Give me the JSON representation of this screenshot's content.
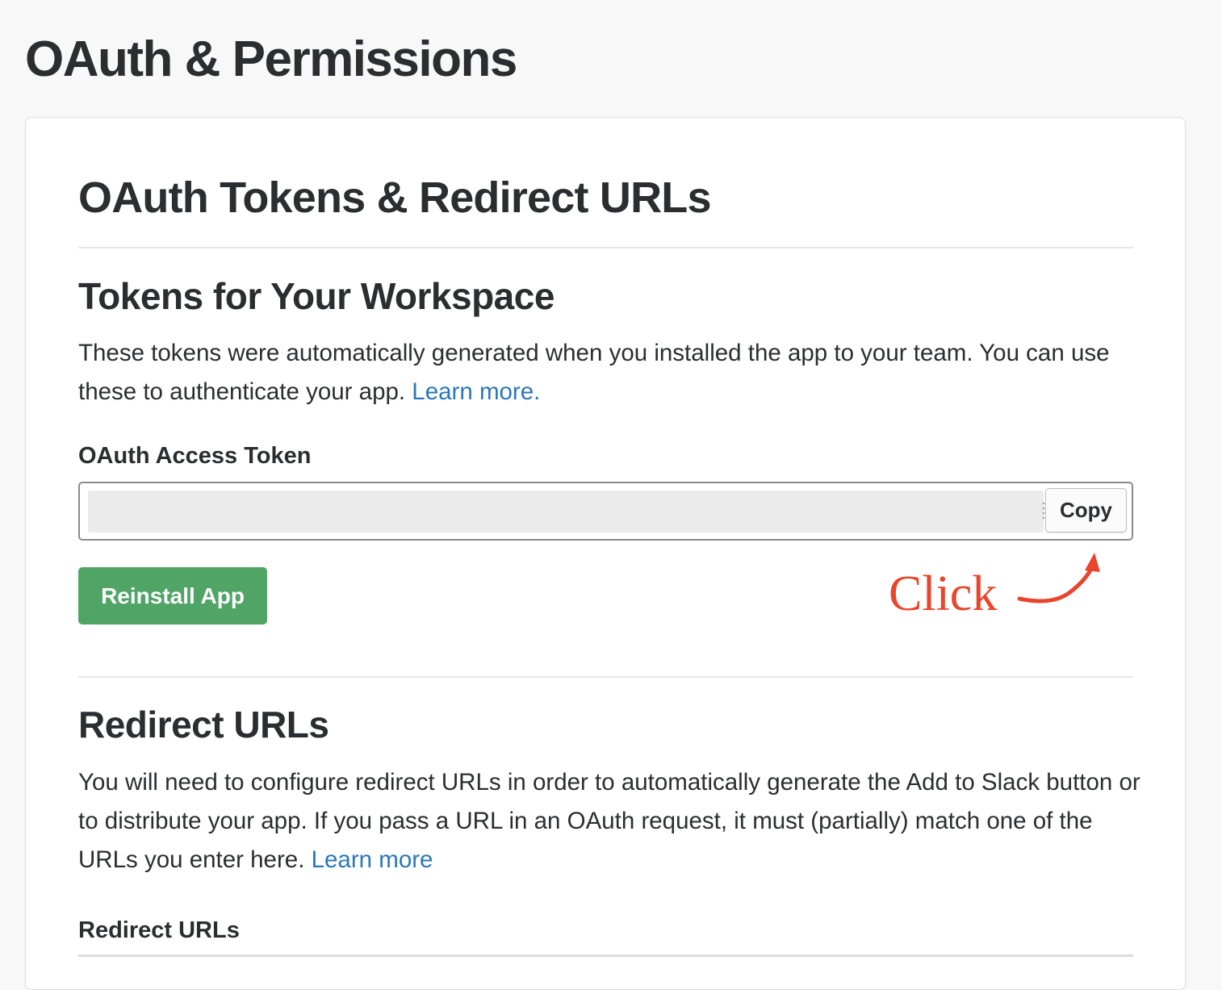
{
  "page": {
    "title": "OAuth & Permissions"
  },
  "card": {
    "title": "OAuth Tokens & Redirect URLs",
    "tokens_section": {
      "title": "Tokens for Your Workspace",
      "description": "These tokens were automatically generated when you installed the app to your team. You can use these to authenticate your app. ",
      "learn_more": "Learn more.",
      "token_label": "OAuth Access Token",
      "token_value": "",
      "copy_label": "Copy",
      "reinstall_label": "Reinstall App"
    },
    "redirect_section": {
      "title": "Redirect URLs",
      "description": "You will need to configure redirect URLs in order to automatically generate the Add to Slack button or to distribute your app. If you pass a URL in an OAuth request, it must (partially) match one of the URLs you enter here. ",
      "learn_more": "Learn more",
      "field_label": "Redirect URLs"
    }
  },
  "annotation": {
    "text": "Click",
    "color": "#e8462c"
  },
  "colors": {
    "link": "#2a77b9",
    "primary_button": "#4fa466",
    "text": "#2c2d30",
    "background": "#f8f8f8"
  }
}
